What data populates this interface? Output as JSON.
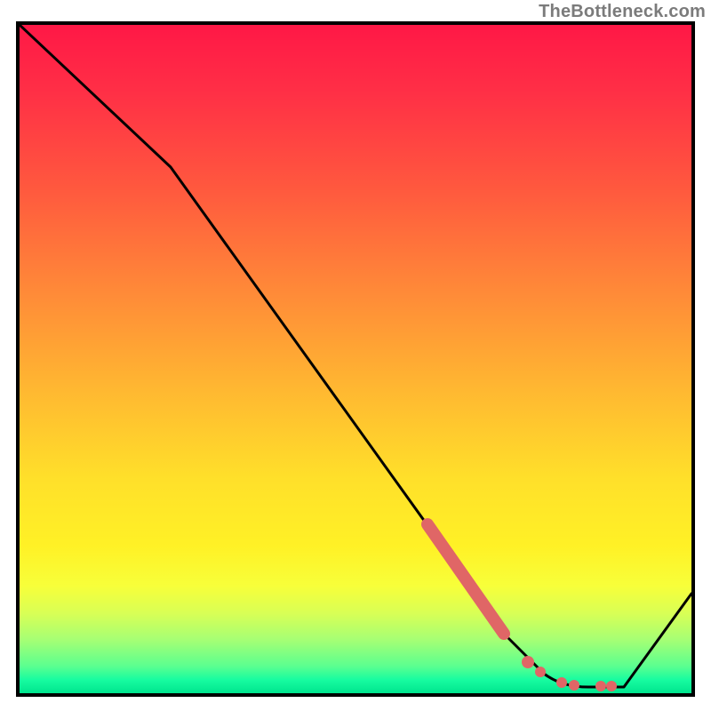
{
  "attribution": "TheBottleneck.com",
  "chart_data": {
    "type": "line",
    "title": "",
    "xlabel": "",
    "ylabel": "",
    "x_range": [
      0,
      100
    ],
    "y_range": [
      0,
      100
    ],
    "background": {
      "style": "vertical-gradient",
      "stops": [
        {
          "pos": 0.0,
          "color": "#ff1846"
        },
        {
          "pos": 0.25,
          "color": "#ff5a3e"
        },
        {
          "pos": 0.55,
          "color": "#ffb931"
        },
        {
          "pos": 0.78,
          "color": "#fff126"
        },
        {
          "pos": 0.92,
          "color": "#a6ff74"
        },
        {
          "pos": 1.0,
          "color": "#00e58e"
        }
      ]
    },
    "series": [
      {
        "name": "bottleneck-curve",
        "color": "#000000",
        "x": [
          0,
          22,
          73,
          78,
          85,
          90,
          100
        ],
        "y": [
          100,
          79,
          8,
          3,
          1,
          1,
          15
        ]
      }
    ],
    "highlights": [
      {
        "name": "thick-segment",
        "color": "#e06666",
        "style": "thick",
        "x": [
          61,
          72
        ],
        "y": [
          25,
          9
        ]
      },
      {
        "name": "min-dots",
        "color": "#e06666",
        "style": "dots",
        "x": [
          76,
          78,
          81,
          83,
          86,
          88
        ],
        "y": [
          5,
          3,
          2,
          1,
          1,
          1
        ]
      }
    ],
    "note": "Values estimated from pixel positions; chart has no axis tick labels."
  }
}
